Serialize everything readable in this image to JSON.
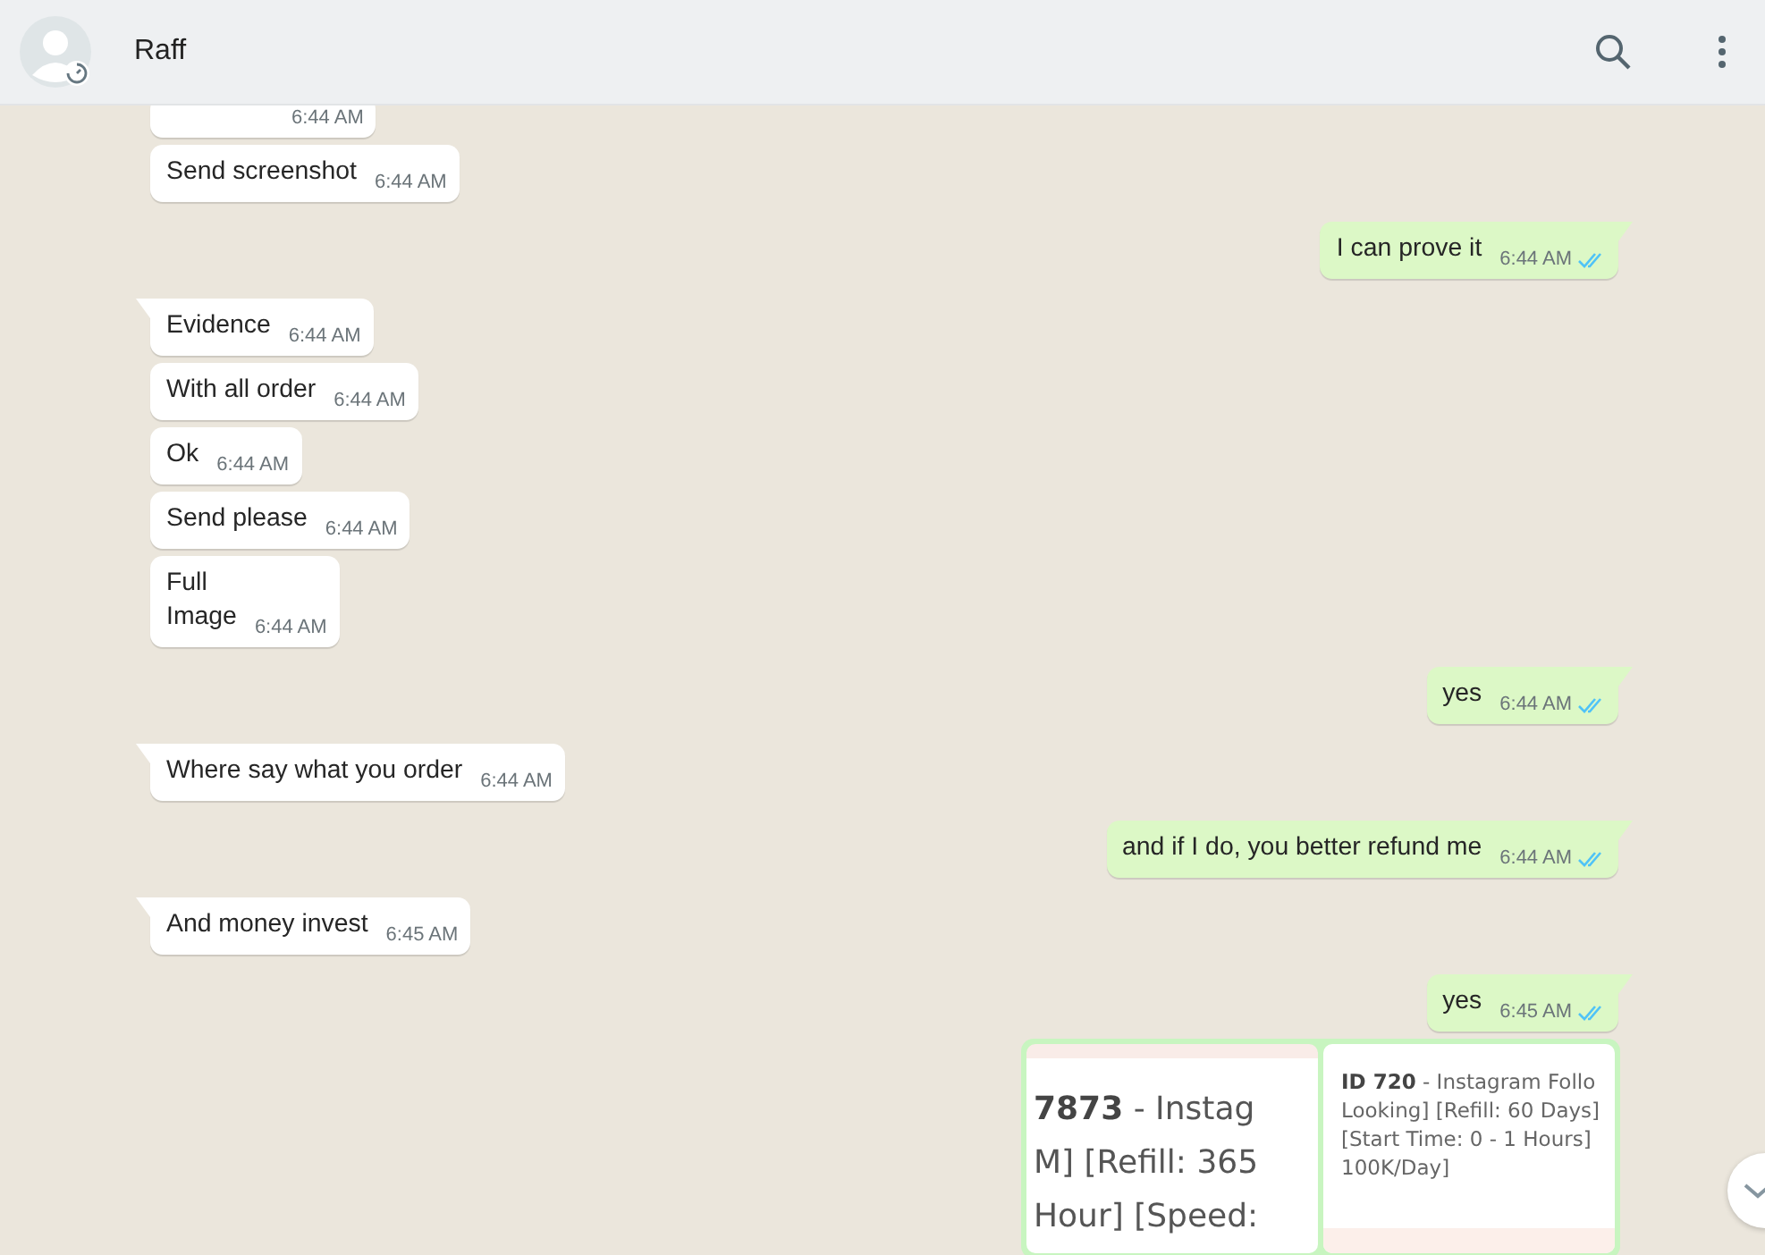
{
  "header": {
    "contact": "Raff"
  },
  "messages": [
    {
      "kind": "received",
      "time": "6:44 AM"
    },
    {
      "kind": "received",
      "text": "Send screenshot",
      "time": "6:44 AM"
    },
    {
      "kind": "sent",
      "tail": true,
      "text": "I can prove it",
      "time": "6:44 AM",
      "read": true
    },
    {
      "kind": "received",
      "tail": true,
      "text": "Evidence",
      "time": "6:44 AM"
    },
    {
      "kind": "received",
      "text": "With all order",
      "time": "6:44 AM"
    },
    {
      "kind": "received",
      "text": "Ok",
      "time": "6:44 AM"
    },
    {
      "kind": "received",
      "text": "Send please",
      "time": "6:44 AM"
    },
    {
      "kind": "received",
      "text": "Full\nImage",
      "time": "6:44 AM"
    },
    {
      "kind": "sent",
      "tail": true,
      "text": "yes",
      "time": "6:44 AM",
      "read": true
    },
    {
      "kind": "received",
      "tail": true,
      "text": "Where say what you order",
      "time": "6:44 AM"
    },
    {
      "kind": "sent",
      "tail": true,
      "text": "and if I do, you better refund me",
      "time": "6:44 AM",
      "read": true
    },
    {
      "kind": "received",
      "tail": true,
      "text": "And money invest",
      "time": "6:45 AM"
    },
    {
      "kind": "sent",
      "tail": true,
      "text": "yes",
      "time": "6:45 AM",
      "read": true
    },
    {
      "kind": "sent_images",
      "left_lines": [
        "**7873** - Instag",
        "M] [Refill: 365",
        "Hour] [Speed:"
      ],
      "right_lines": [
        "**ID 720** - Instagram Follo",
        "Looking] [Refill: 60 Days]",
        "[Start Time: 0 - 1 Hours]",
        "100K/Day]"
      ]
    }
  ]
}
